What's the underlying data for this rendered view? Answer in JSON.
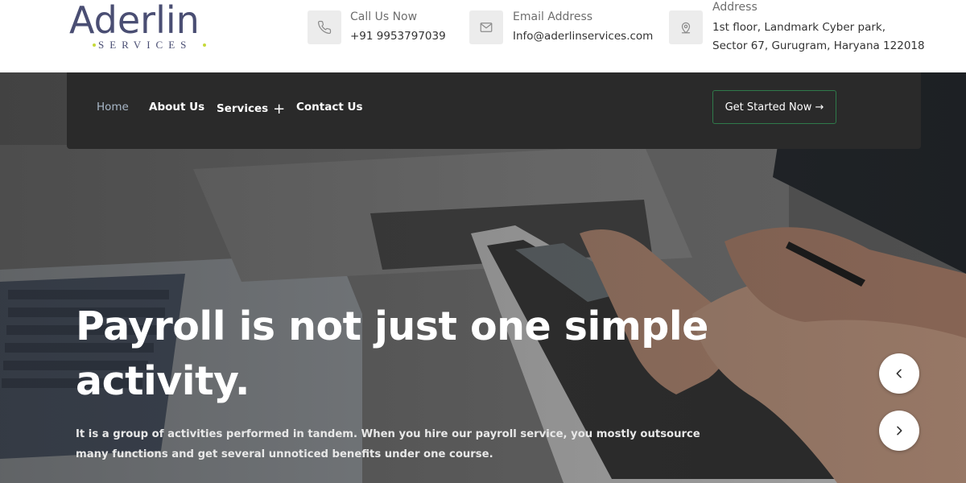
{
  "brand": {
    "name": "Aderlin",
    "tagline": "SERVICES"
  },
  "contacts": [
    {
      "title": "Call Us Now",
      "lines": [
        "+91 9953797039"
      ],
      "icon": "phone-icon"
    },
    {
      "title": "Email Address",
      "lines": [
        "Info@aderlinservices.com"
      ],
      "icon": "mail-icon"
    },
    {
      "title": "Address",
      "lines": [
        "1st floor, Landmark Cyber park,",
        "Sector 67, Gurugram, Haryana 122018"
      ],
      "icon": "location-pin-icon"
    }
  ],
  "nav": {
    "items": [
      {
        "label": "Home",
        "active": true
      },
      {
        "label": "About Us",
        "active": false
      },
      {
        "label": "Services",
        "active": false,
        "expand": "+"
      },
      {
        "label": "Contact Us",
        "active": false
      }
    ],
    "cta_label": "Get Started Now →"
  },
  "hero": {
    "headline": "Payroll is not just one simple activity.",
    "subtext": "It is a group of activities performed in tandem. When you hire our payroll service, you mostly outsource many functions and get several unnoticed benefits under one course.",
    "prev_icon": "chevron-left-icon",
    "next_icon": "chevron-right-icon"
  },
  "colors": {
    "brand": "#4a4e73",
    "brand_accent": "#c6d93a",
    "nav_bg": "#2a2a2a",
    "nav_active": "#a9b8c8",
    "cta_border": "#2f7a4a"
  }
}
